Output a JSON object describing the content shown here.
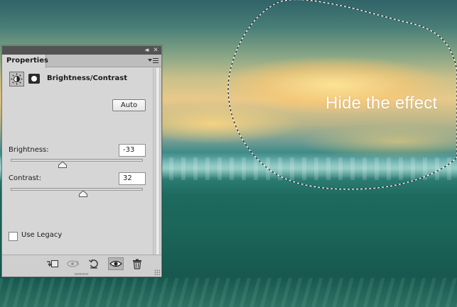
{
  "canvas": {
    "caption": "Hide the effect"
  },
  "panel": {
    "tab_label": "Properties",
    "collapse_glyph": "◂◂",
    "close_glyph": "✕",
    "adjustment_title": "Brightness/Contrast",
    "auto_label": "Auto",
    "brightness": {
      "label": "Brightness:",
      "value": "-33",
      "min": -150,
      "max": 150,
      "level": -33
    },
    "contrast": {
      "label": "Contrast:",
      "value": "32",
      "min": -50,
      "max": 100,
      "level": 32
    },
    "use_legacy": {
      "label": "Use Legacy",
      "checked": false
    },
    "footer_buttons": [
      {
        "name": "clip-to-layer-icon"
      },
      {
        "name": "view-previous-state-icon"
      },
      {
        "name": "reset-icon"
      },
      {
        "name": "toggle-visibility-icon",
        "active": true
      },
      {
        "name": "delete-icon"
      }
    ]
  }
}
